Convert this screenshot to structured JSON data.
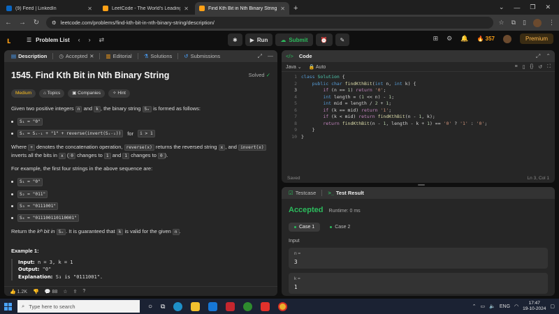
{
  "browser": {
    "tabs": [
      {
        "title": "(9) Feed | LinkedIn",
        "color": "#0a66c2",
        "active": false
      },
      {
        "title": "LeetCode - The World's Leading",
        "color": "#ffa116",
        "active": false
      },
      {
        "title": "Find Kth Bit in Nth Binary String",
        "color": "#ffa116",
        "active": true
      }
    ],
    "url": "leetcode.com/problems/find-kth-bit-in-nth-binary-string/description/"
  },
  "header": {
    "problem_list": "Problem List",
    "run": "Run",
    "submit": "Submit",
    "streak": "357",
    "premium": "Premium"
  },
  "left_tabs": [
    "Description",
    "Accepted",
    "Editorial",
    "Solutions",
    "Submissions"
  ],
  "problem": {
    "title": "1545. Find Kth Bit in Nth Binary String",
    "solved": "Solved",
    "tags": [
      "Medium",
      "Topics",
      "Companies",
      "Hint"
    ],
    "p1a": "Given two positive integers",
    "p1_n": "n",
    "p1_and": "and",
    "p1_k": "k",
    "p1b": ", the binary string",
    "p1_sn": "Sₙ",
    "p1c": "is formed as follows:",
    "rule1": "S₁ = \"0\"",
    "rule2": "Sᵢ = Sᵢ₋₁ + \"1\" + reverse(invert(Sᵢ₋₁))",
    "rule2_for": "for",
    "rule2_cond": "i > 1",
    "p2a": "Where",
    "p2_plus": "+",
    "p2b": "denotes the concatenation operation,",
    "p2_rev": "reverse(x)",
    "p2c": "returns the reversed string",
    "p2_x": "x",
    "p2d": ", and",
    "p2_inv": "invert(x)",
    "p2e": "inverts all the bits in",
    "p2_x2": "x",
    "p2f": "(",
    "p2_0": "0",
    "p2g": "changes to",
    "p2_1": "1",
    "p2h": "and",
    "p2_1b": "1",
    "p2i": "changes to",
    "p2_0b": "0",
    "p2j": ").",
    "p3": "For example, the first four strings in the above sequence are:",
    "examples": [
      "S₁ = \"0\"",
      "S₂ = \"011\"",
      "S₃ = \"0111001\"",
      "S₄ = \"011100110110001\""
    ],
    "p4a": "Return the",
    "p4_kth": "kᵗʰ bit in",
    "p4_sn": "Sₙ",
    "p4b": ". It is guaranteed that",
    "p4_k": "k",
    "p4c": "is valid for the given",
    "p4_n": "n",
    "p4d": ".",
    "ex1_title": "Example 1:",
    "ex1_input_label": "Input:",
    "ex1_input": "n = 3, k = 1",
    "ex1_output_label": "Output:",
    "ex1_output": "\"0\"",
    "ex1_expl_label": "Explanation:",
    "ex1_expl": "S₃ is \"0111001\"."
  },
  "footer": {
    "likes": "1.2K",
    "comments": "88"
  },
  "code": {
    "title": "Code",
    "language": "Java",
    "mode": "Auto",
    "status_left": "Saved",
    "status_right": "Ln 3, Col 1",
    "line_numbers": [
      "1",
      "2",
      "3",
      "4",
      "5",
      "6",
      "7",
      "8",
      "9",
      "10"
    ]
  },
  "result": {
    "tabs": [
      "Testcase",
      "Test Result"
    ],
    "verdict": "Accepted",
    "runtime": "Runtime: 0 ms",
    "cases": [
      "Case 1",
      "Case 2"
    ],
    "input_label": "Input",
    "inputs": [
      {
        "name": "n =",
        "value": "3"
      },
      {
        "name": "k =",
        "value": "1"
      }
    ]
  },
  "taskbar": {
    "search_placeholder": "Type here to search",
    "lang": "ENG",
    "time": "17:47",
    "date": "19-10-2024"
  }
}
